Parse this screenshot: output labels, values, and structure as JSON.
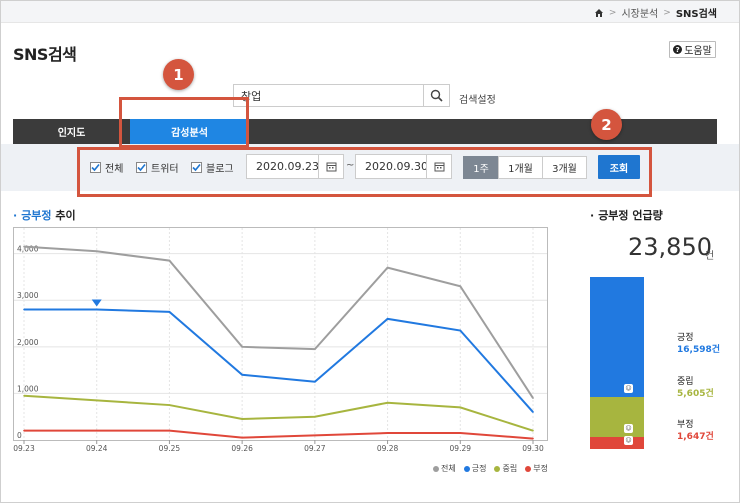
{
  "breadcrumb": {
    "home_icon": "home-icon",
    "items": [
      "시장분석",
      "SNS검색"
    ]
  },
  "page": {
    "title": "SNS검색",
    "help_label": "도움말"
  },
  "search": {
    "value": "창업",
    "setting_label": "검색설정"
  },
  "tabs": [
    {
      "label": "인지도",
      "active": false
    },
    {
      "label": "감성분석",
      "active": true
    }
  ],
  "filters": {
    "checkboxes": [
      {
        "label": "전체",
        "checked": true
      },
      {
        "label": "트위터",
        "checked": true
      },
      {
        "label": "블로그",
        "checked": true
      }
    ],
    "start_date": "2020.09.23",
    "end_date": "2020.09.30",
    "tilde": "~",
    "periods": [
      {
        "label": "1주",
        "active": true
      },
      {
        "label": "1개월",
        "active": false
      },
      {
        "label": "3개월",
        "active": false
      }
    ],
    "query_label": "조회"
  },
  "markers": [
    "1",
    "2"
  ],
  "trend": {
    "title_highlight": "긍부정",
    "title_rest": " 추이"
  },
  "mentions": {
    "title": "긍부정 언급량",
    "total": "23,850",
    "unit": "건",
    "items": [
      {
        "label": "긍정",
        "value": "16,598건",
        "count": 16598,
        "color": "#2179e0"
      },
      {
        "label": "중립",
        "value": "5,605건",
        "count": 5605,
        "color": "#a7b53f"
      },
      {
        "label": "부정",
        "value": "1,647건",
        "count": 1647,
        "color": "#e0473a"
      }
    ]
  },
  "chart_data": {
    "type": "line",
    "x": [
      "09.23",
      "09.24",
      "09.25",
      "09.26",
      "09.27",
      "09.28",
      "09.29",
      "09.30"
    ],
    "ylim": [
      0,
      4400
    ],
    "yticks": [
      "0",
      "1,000",
      "2,000",
      "3,000",
      "4,000"
    ],
    "ytick_values": [
      0,
      1000,
      2000,
      3000,
      4000
    ],
    "grid": true,
    "legend_position": "bottom-right",
    "series": [
      {
        "name": "전체",
        "color": "#9e9e9e",
        "values": [
          4150,
          4050,
          3850,
          2000,
          1950,
          3700,
          3300,
          900
        ]
      },
      {
        "name": "긍정",
        "color": "#2179e0",
        "values": [
          2800,
          2800,
          2750,
          1400,
          1250,
          2600,
          2350,
          600
        ]
      },
      {
        "name": "중립",
        "color": "#a7b53f",
        "values": [
          950,
          850,
          750,
          450,
          500,
          800,
          700,
          200
        ]
      },
      {
        "name": "부정",
        "color": "#e0473a",
        "values": [
          200,
          200,
          200,
          50,
          100,
          150,
          150,
          30
        ]
      }
    ],
    "highlight": {
      "series": "긍정",
      "x": "09.24"
    }
  }
}
